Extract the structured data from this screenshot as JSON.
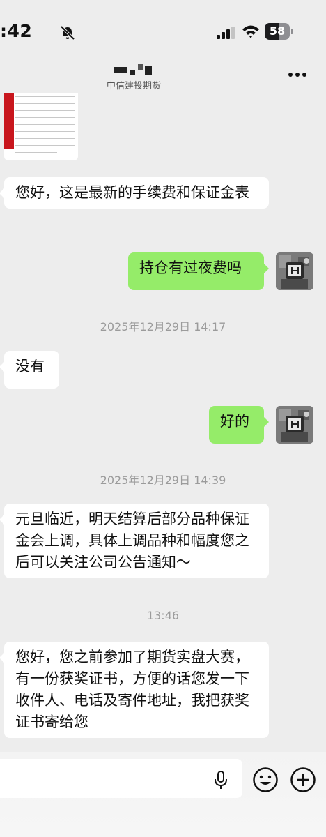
{
  "status_bar": {
    "time": ":42",
    "battery": "58",
    "battery_level": 0.58
  },
  "nav": {
    "subtitle": "中信建投期货",
    "more_icon": "more-icon"
  },
  "messages": [
    {
      "type": "image",
      "side": "left",
      "desc_icon": "image-thumbnail"
    },
    {
      "type": "text",
      "side": "left",
      "text": "您好，这是最新的手续费和保证金表"
    },
    {
      "type": "text",
      "side": "right",
      "text": "持仓有过夜费吗"
    },
    {
      "type": "time",
      "text": "2025年12月29日 14:17"
    },
    {
      "type": "text",
      "side": "left",
      "text": "没有"
    },
    {
      "type": "text",
      "side": "right",
      "text": "好的"
    },
    {
      "type": "time",
      "text": "2025年12月29日 14:39"
    },
    {
      "type": "text",
      "side": "left",
      "text": "元旦临近，明天结算后部分品种保证金会上调，具体上调品种和幅度您之后可以关注公司公告通知～"
    },
    {
      "type": "time",
      "text": "13:46"
    },
    {
      "type": "text",
      "side": "left",
      "text": "您好，您之前参加了期货实盘大赛，有一份获奖证书，方便的话您发一下收件人、电话及寄件地址，我把获奖证书寄给您"
    }
  ],
  "input_bar": {
    "icons": [
      "mic-icon",
      "emoji-icon",
      "plus-icon"
    ]
  },
  "colors": {
    "background": "#ededed",
    "self_bubble": "#95ec69",
    "other_bubble": "#ffffff"
  }
}
